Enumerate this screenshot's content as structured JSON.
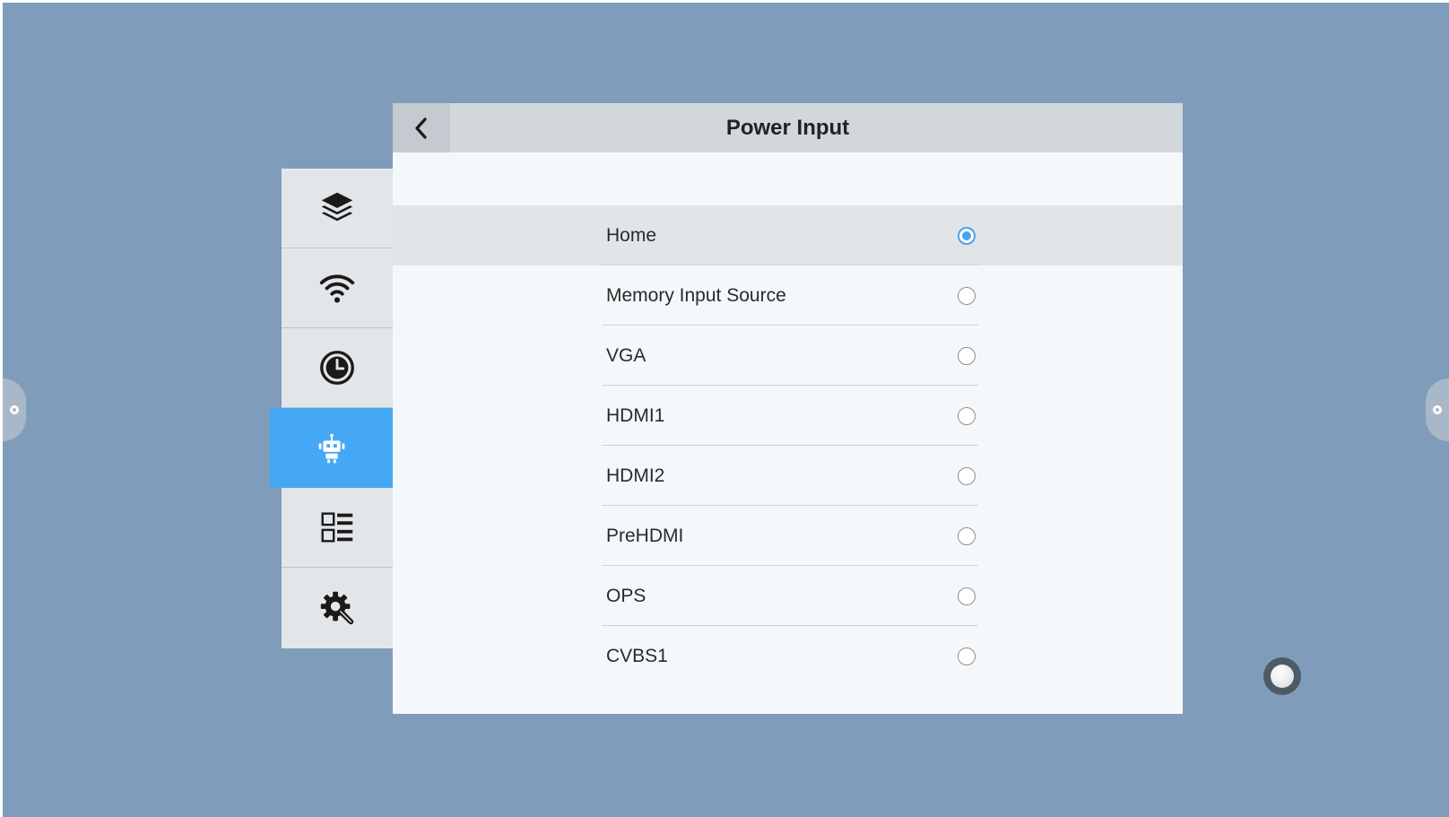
{
  "colors": {
    "background": "#7f9dbb",
    "sidebar": "#e3e6e9",
    "sidebar_active": "#45a8f5",
    "panel": "#f4f8fb",
    "header": "#d2d7db",
    "radio_checked": "#4aa3ee"
  },
  "edge_handles": [
    {
      "name": "left-edge-handle",
      "icon": "ring-icon"
    },
    {
      "name": "right-edge-handle",
      "icon": "ring-icon"
    }
  ],
  "floating_button": {
    "icon": "assistive-touch-icon"
  },
  "sidebar": {
    "items": [
      {
        "icon": "layers-icon",
        "active": false
      },
      {
        "icon": "wifi-icon",
        "active": false
      },
      {
        "icon": "clock-icon",
        "active": false
      },
      {
        "icon": "robot-icon",
        "active": true
      },
      {
        "icon": "apps-list-icon",
        "active": false
      },
      {
        "icon": "gear-wrench-icon",
        "active": false
      }
    ]
  },
  "panel": {
    "back_icon": "chevron-left-icon",
    "title": "Power Input",
    "options": [
      {
        "label": "Home",
        "selected": true
      },
      {
        "label": "Memory Input Source",
        "selected": false
      },
      {
        "label": "VGA",
        "selected": false
      },
      {
        "label": "HDMI1",
        "selected": false
      },
      {
        "label": "HDMI2",
        "selected": false
      },
      {
        "label": "PreHDMI",
        "selected": false
      },
      {
        "label": "OPS",
        "selected": false
      },
      {
        "label": "CVBS1",
        "selected": false
      }
    ]
  }
}
